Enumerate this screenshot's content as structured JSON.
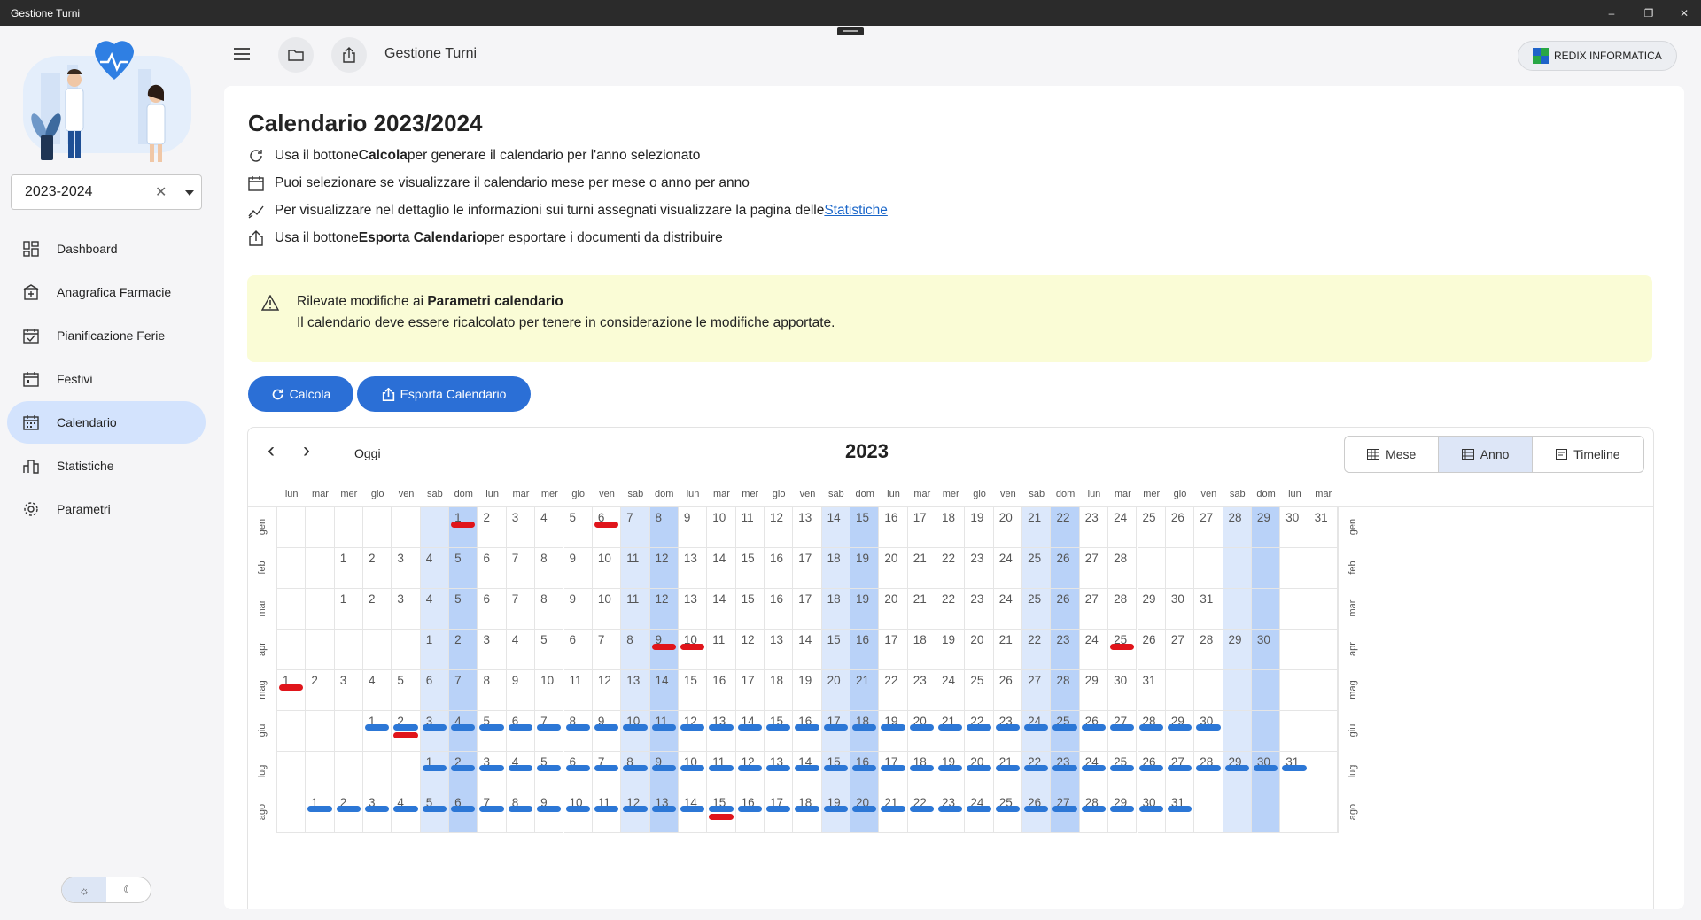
{
  "window": {
    "title": "Gestione Turni",
    "controls": [
      "–",
      "❐",
      "✕"
    ]
  },
  "sidebar": {
    "year_select": {
      "value": "2023-2024"
    },
    "nav": [
      {
        "label": "Dashboard",
        "icon": "dashboard-icon"
      },
      {
        "label": "Anagrafica Farmacie",
        "icon": "pharmacy-icon"
      },
      {
        "label": "Pianificazione Ferie",
        "icon": "calendar-check-icon"
      },
      {
        "label": "Festivi",
        "icon": "calendar-icon"
      },
      {
        "label": "Calendario",
        "icon": "calendar-grid-icon",
        "active": true
      },
      {
        "label": "Statistiche",
        "icon": "bar-chart-icon"
      },
      {
        "label": "Parametri",
        "icon": "gear-icon"
      }
    ],
    "theme": {
      "light_icon": "☼",
      "dark_icon": "☾"
    }
  },
  "header": {
    "title": "Gestione Turni",
    "company": "REDIX INFORMATICA"
  },
  "main": {
    "title": "Calendario 2023/2024",
    "info": [
      {
        "pre": "Usa il bottone ",
        "bold": "Calcola",
        "post": " per generare il calendario per l'anno selezionato",
        "link": ""
      },
      {
        "pre": "Puoi selezionare se visualizzare il calendario mese per mese o anno per anno",
        "bold": "",
        "post": "",
        "link": ""
      },
      {
        "pre": "Per visualizzare nel dettaglio le informazioni sui turni assegnati visualizzare la pagina delle ",
        "bold": "",
        "post": "",
        "link": "Statistiche"
      },
      {
        "pre": "Usa il bottone ",
        "bold": "Esporta Calendario",
        "post": " per esportare i documenti da distribuire",
        "link": ""
      }
    ],
    "warning": {
      "line1_pre": "Rilevate modifiche ai ",
      "line1_bold": "Parametri calendario",
      "line2": "Il calendario deve essere ricalcolato per tenere in considerazione le modifiche apportate."
    },
    "buttons": {
      "calcola": "Calcola",
      "esporta": "Esporta Calendario"
    }
  },
  "calendar": {
    "today": "Oggi",
    "prev": "‹",
    "next": "›",
    "year": "2023",
    "views": [
      "Mese",
      "Anno",
      "Timeline"
    ],
    "active_view": "Anno",
    "weekdays": [
      "lun",
      "mar",
      "mer",
      "gio",
      "ven",
      "sab",
      "dom"
    ],
    "colors": {
      "weekend_sat": "#dce8fb",
      "weekend_sun": "#b9d2f8",
      "holiday_bar": "#e0151b",
      "shift_bar": "#2c77d6"
    },
    "months": [
      {
        "label": "gen",
        "offset": 6,
        "days": 31
      },
      {
        "label": "feb",
        "offset": 2,
        "days": 28
      },
      {
        "label": "mar",
        "offset": 2,
        "days": 31
      },
      {
        "label": "apr",
        "offset": 5,
        "days": 30
      },
      {
        "label": "mag",
        "offset": 0,
        "days": 31
      },
      {
        "label": "giu",
        "offset": 3,
        "days": 30
      },
      {
        "label": "lug",
        "offset": 5,
        "days": 31
      },
      {
        "label": "ago",
        "offset": 1,
        "days": 31
      }
    ],
    "holidays": [
      [
        0,
        1
      ],
      [
        0,
        6
      ],
      [
        3,
        9
      ],
      [
        3,
        10
      ],
      [
        3,
        25
      ],
      [
        4,
        1
      ],
      [
        5,
        2
      ],
      [
        7,
        15
      ]
    ],
    "shift_months": [
      5,
      6,
      7
    ]
  }
}
